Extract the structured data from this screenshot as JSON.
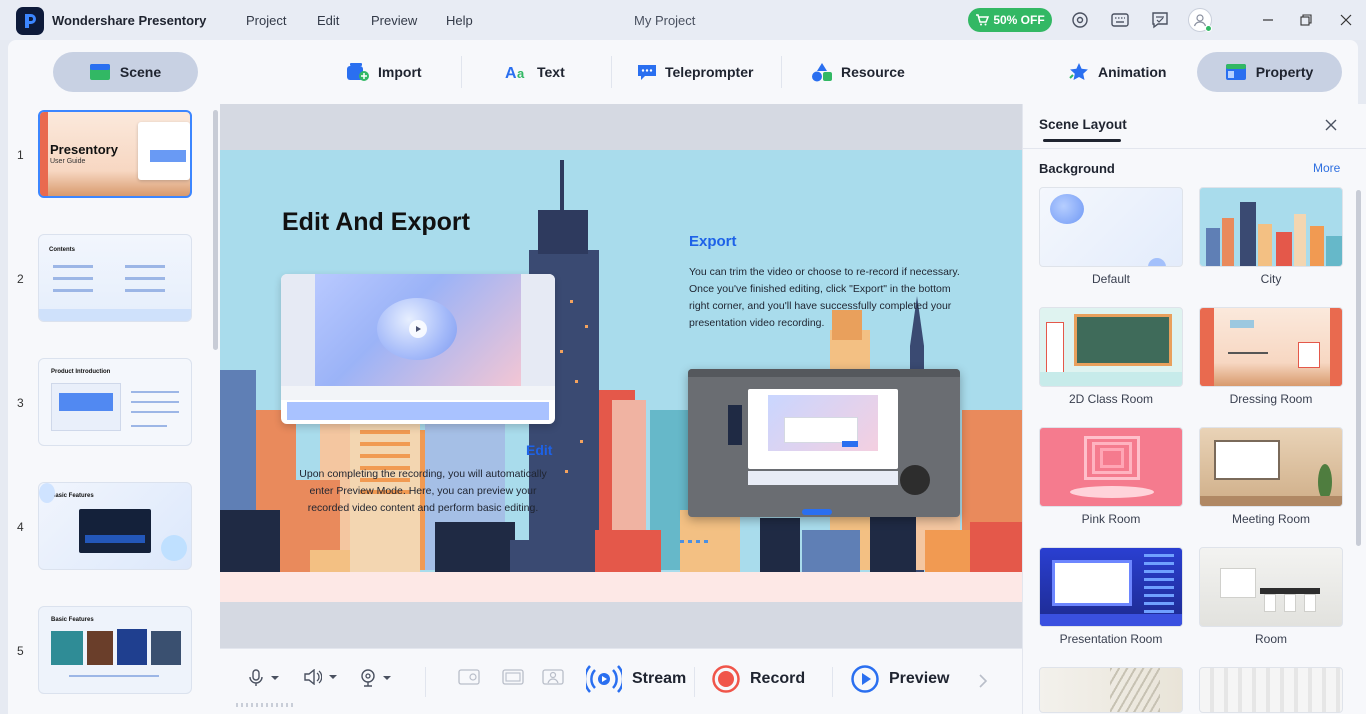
{
  "app": {
    "title": "Wondershare Presentory",
    "project": "My Project",
    "menus": [
      "Project",
      "Edit",
      "Preview",
      "Help"
    ],
    "promo": "50% OFF"
  },
  "toolbar": {
    "scene": "Scene",
    "import": "Import",
    "text": "Text",
    "teleprompter": "Teleprompter",
    "resource": "Resource",
    "animation": "Animation",
    "property": "Property"
  },
  "slides": [
    {
      "number": "1",
      "title": "Presentory",
      "subtitle": "User Guide"
    },
    {
      "number": "2",
      "title": "Contents"
    },
    {
      "number": "3",
      "title": "Product Introduction"
    },
    {
      "number": "4",
      "title": "Basic Features"
    },
    {
      "number": "5",
      "title": "Basic Features"
    }
  ],
  "canvas": {
    "title": "Edit And Export",
    "export_heading": "Export",
    "export_body": "You can trim the video or choose to re-record if necessary. Once you've finished editing, click \"Export\" in the bottom right corner, and you'll have successfully completed your presentation video recording.",
    "edit_heading": "Edit",
    "edit_body": "Upon completing the recording, you will automatically enter Preview Mode. Here, you can preview your recorded video content and perform basic editing."
  },
  "bottombar": {
    "stream": "Stream",
    "record": "Record",
    "preview": "Preview"
  },
  "panel": {
    "title": "Scene Layout",
    "section": "Background",
    "more": "More",
    "backgrounds": [
      {
        "label": "Default"
      },
      {
        "label": "City"
      },
      {
        "label": "2D Class Room"
      },
      {
        "label": "Dressing Room"
      },
      {
        "label": "Pink Room"
      },
      {
        "label": "Meeting Room"
      },
      {
        "label": "Presentation Room"
      },
      {
        "label": "Room"
      }
    ]
  },
  "colors": {
    "accent": "#1d62e8",
    "pill": "#c8d1e3",
    "promo": "#32b864",
    "record": "#f0554a",
    "preview": "#2a6ff0"
  },
  "icons": [
    "logo-icon",
    "cart-icon",
    "target-icon",
    "keyboard-icon",
    "feedback-icon",
    "user-icon",
    "minimize-icon",
    "restore-icon",
    "close-icon",
    "scene-icon",
    "import-icon",
    "text-icon",
    "teleprompter-icon",
    "resource-icon",
    "animation-icon",
    "property-icon",
    "microphone-icon",
    "speaker-icon",
    "webcam-icon",
    "stream-icon",
    "record-icon",
    "preview-icon",
    "chevron-right-icon"
  ]
}
